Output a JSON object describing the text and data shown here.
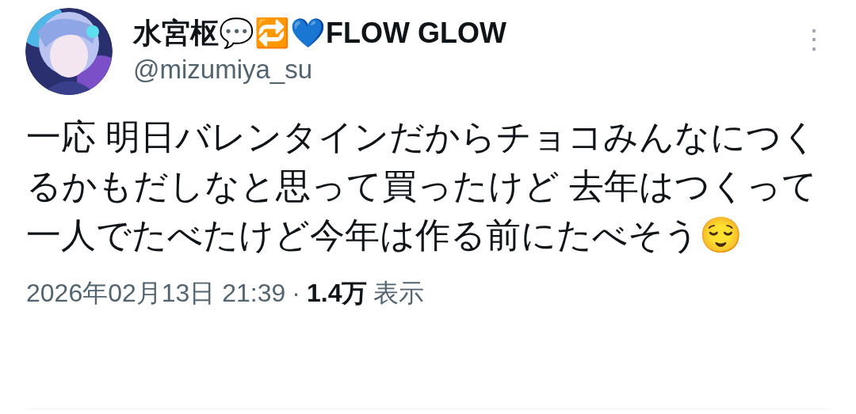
{
  "author": {
    "name": "水宮枢💬🔁💙FLOW GLOW",
    "handle": "@mizumiya_su"
  },
  "more_button": {
    "label": "⋮"
  },
  "post": {
    "text": "一応 明日バレンタインだからチョコみんなにつくるかもだしなと思って買ったけど 去年はつくって一人でたべたけど今年は作る前にたべそう😌"
  },
  "meta": {
    "timestamp": "2026年02月13日 21:39",
    "separator": "·",
    "views_count": "1.4万",
    "views_label": "表示"
  }
}
